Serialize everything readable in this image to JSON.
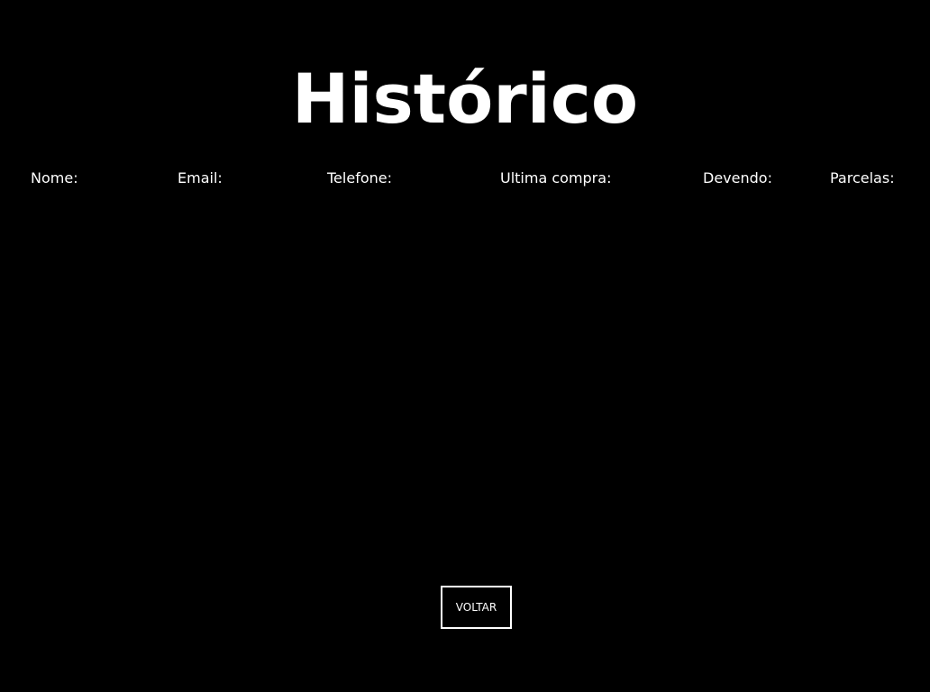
{
  "page": {
    "title": "Histórico",
    "background_color": "#000000",
    "text_color": "#ffffff"
  },
  "table": {
    "columns": [
      "Nome:",
      "Email:",
      "Telefone:",
      "Ultima compra:",
      "Devendo:",
      "Parcelas:"
    ],
    "rows": []
  },
  "actions": {
    "back_label": "VOLTAR"
  }
}
